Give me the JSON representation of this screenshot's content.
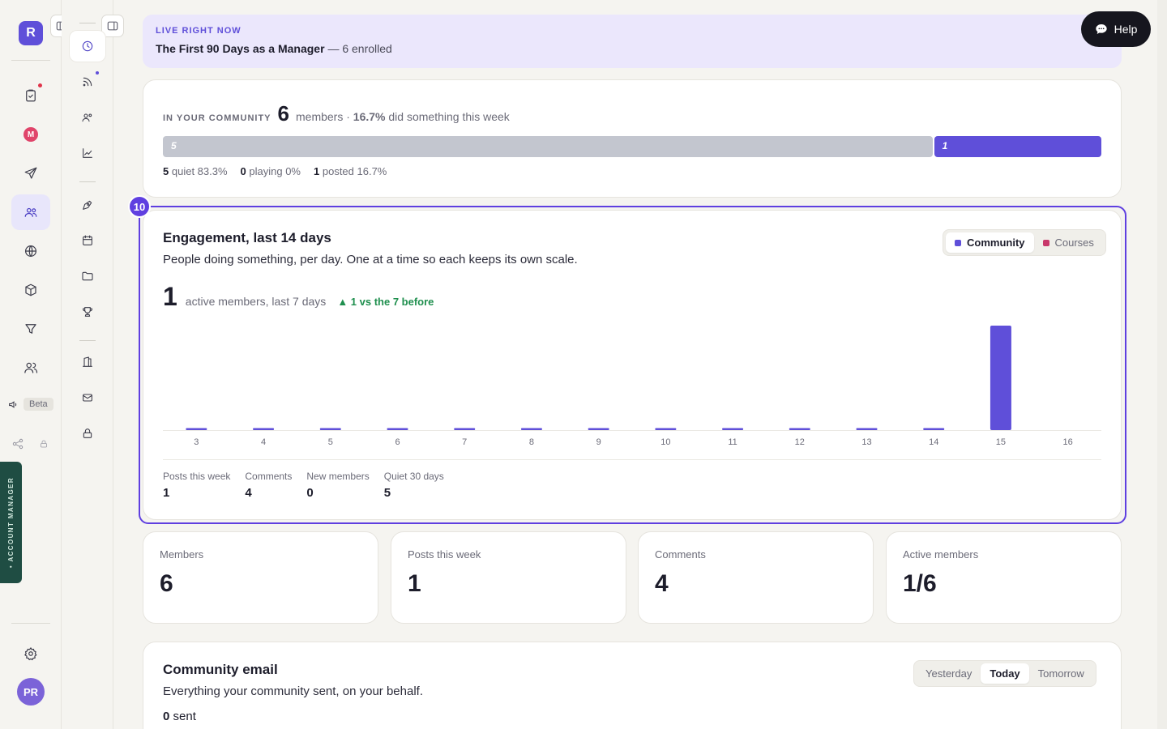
{
  "app": {
    "logo_letter": "R",
    "user_initials": "PR",
    "beta_label": "Beta",
    "account_manager_label": "• ACCOUNT MANAGER",
    "m_badge": "M"
  },
  "banner": {
    "kicker": "LIVE RIGHT NOW",
    "course_title": "The First 90 Days as a Manager",
    "enrolled_text": "— 6 enrolled"
  },
  "help": {
    "label": "Help"
  },
  "community": {
    "kicker": "IN YOUR COMMUNITY",
    "member_count": "6",
    "members_word": "members ·",
    "active_pct": "16.7%",
    "active_text": "did something this week",
    "segments": [
      {
        "label": "5",
        "share": 0.833,
        "color": "#c3c6cf"
      },
      {
        "label": "1",
        "share": 0.167,
        "color": "#5f4fd9"
      }
    ],
    "legend": [
      {
        "count": "5",
        "text": "quiet 83.3%"
      },
      {
        "count": "0",
        "text": "playing 0%"
      },
      {
        "count": "1",
        "text": "posted 16.7%"
      }
    ]
  },
  "engagement": {
    "badge": "10",
    "title": "Engagement, last 14 days",
    "subtitle": "People doing something, per day. One at a time so each keeps its own scale.",
    "toggle": [
      {
        "label": "Community",
        "active": true,
        "color": "#5f4fd9"
      },
      {
        "label": "Courses",
        "active": false,
        "color": "#c8386b"
      }
    ],
    "metric_value": "1",
    "metric_label": "active members, last 7 days",
    "metric_delta": "▲ 1 vs the 7 before",
    "stats": [
      {
        "label": "Posts this week",
        "value": "1"
      },
      {
        "label": "Comments",
        "value": "4"
      },
      {
        "label": "New members",
        "value": "0"
      },
      {
        "label": "Quiet 30 days",
        "value": "5"
      }
    ]
  },
  "chart_data": {
    "type": "bar",
    "categories": [
      "3",
      "4",
      "5",
      "6",
      "7",
      "8",
      "9",
      "10",
      "11",
      "12",
      "13",
      "14",
      "15",
      "16"
    ],
    "values": [
      0,
      0,
      0,
      0,
      0,
      0,
      0,
      0,
      0,
      0,
      0,
      0,
      1,
      0
    ],
    "bar_color": "#5f4fd9",
    "ylim": [
      0,
      1
    ],
    "grid": false
  },
  "kpis": [
    {
      "label": "Members",
      "value": "6"
    },
    {
      "label": "Posts this week",
      "value": "1"
    },
    {
      "label": "Comments",
      "value": "4"
    },
    {
      "label": "Active members",
      "value": "1/6"
    }
  ],
  "email": {
    "title": "Community email",
    "subtitle": "Everything your community sent, on your behalf.",
    "sent_count": "0",
    "sent_word": "sent",
    "toggle": [
      {
        "label": "Yesterday",
        "active": false
      },
      {
        "label": "Today",
        "active": true
      },
      {
        "label": "Tomorrow",
        "active": false
      }
    ]
  }
}
